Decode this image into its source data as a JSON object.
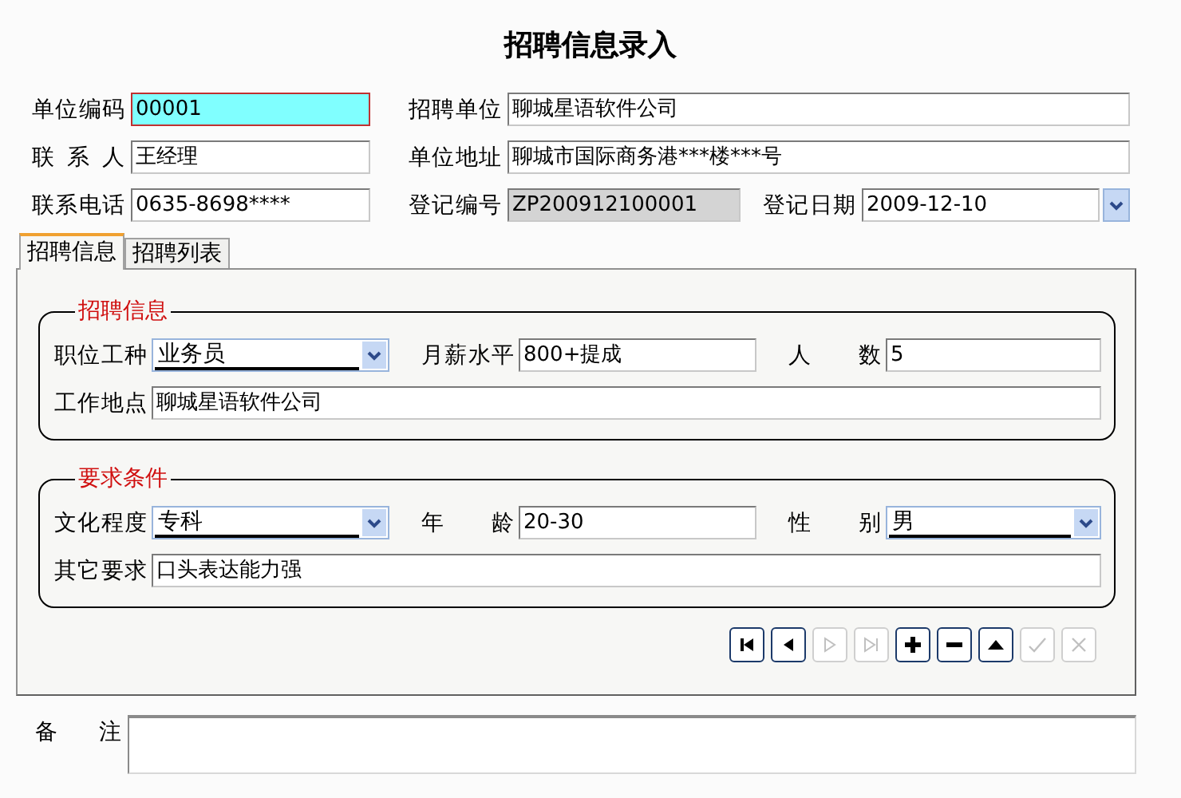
{
  "title": "招聘信息录入",
  "header": {
    "fields": [
      {
        "label": "单位编码",
        "value": "00001",
        "kind": "text",
        "focused": true
      },
      {
        "label": "招聘单位",
        "value": "聊城星语软件公司",
        "kind": "text"
      },
      {
        "label": "联 系 人",
        "value": "王经理",
        "kind": "text"
      },
      {
        "label": "单位地址",
        "value": "聊城市国际商务港***楼***号",
        "kind": "text"
      },
      {
        "label": "联系电话",
        "value": "0635-8698****",
        "kind": "text"
      },
      {
        "label": "登记编号",
        "value": "ZP200912100001",
        "kind": "readonly"
      },
      {
        "label": "登记日期",
        "value": "2009-12-10",
        "kind": "date"
      }
    ]
  },
  "tabs": [
    {
      "label": "招聘信息",
      "selected": true
    },
    {
      "label": "招聘列表",
      "selected": false
    }
  ],
  "groups": [
    {
      "title": "招聘信息",
      "rows": [
        [
          {
            "label": "职位工种",
            "value": "业务员",
            "kind": "combo"
          },
          {
            "label": "月薪水平",
            "value": "800+提成",
            "kind": "text"
          },
          {
            "label": "人 数",
            "value": "5",
            "kind": "text"
          }
        ],
        [
          {
            "label": "工作地点",
            "value": "聊城星语软件公司",
            "kind": "text"
          }
        ]
      ]
    },
    {
      "title": "要求条件",
      "rows": [
        [
          {
            "label": "文化程度",
            "value": "专科",
            "kind": "combo"
          },
          {
            "label": "年 龄",
            "value": "20-30",
            "kind": "text"
          },
          {
            "label": "性 别",
            "value": "男",
            "kind": "combo"
          }
        ],
        [
          {
            "label": "其它要求",
            "value": "口头表达能力强",
            "kind": "text"
          }
        ]
      ]
    }
  ],
  "navigator": [
    {
      "kind": "first",
      "disabled": false
    },
    {
      "kind": "prior",
      "disabled": false
    },
    {
      "kind": "next",
      "disabled": true
    },
    {
      "kind": "last",
      "disabled": true
    },
    {
      "kind": "insert",
      "disabled": false
    },
    {
      "kind": "delete",
      "disabled": false
    },
    {
      "kind": "edit",
      "disabled": false
    },
    {
      "kind": "post",
      "disabled": true
    },
    {
      "kind": "cancel",
      "disabled": true
    }
  ],
  "remark": {
    "label": "备 注"
  }
}
